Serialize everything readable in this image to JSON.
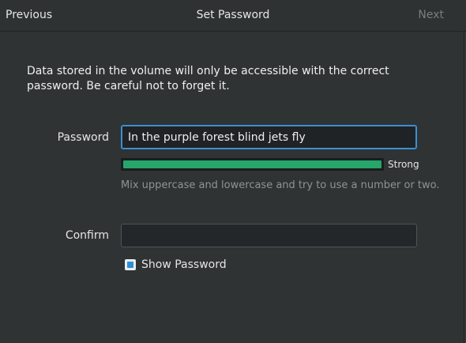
{
  "header": {
    "previous_label": "Previous",
    "title": "Set Password",
    "next_label": "Next"
  },
  "description": "Data stored in the volume will only be accessible with the correct password. Be careful not to forget it.",
  "password": {
    "label": "Password",
    "value": "In the purple forest blind jets fly",
    "strength_label": "Strong",
    "strength_level": 1.0,
    "hint": "Mix uppercase and lowercase and try to use a number or two."
  },
  "confirm": {
    "label": "Confirm",
    "value": ""
  },
  "show_password": {
    "label": "Show Password",
    "checked": true
  },
  "colors": {
    "accent": "#3d8fd1",
    "strength_fill": "#26a66b",
    "checkbox": "#2e90d6"
  }
}
